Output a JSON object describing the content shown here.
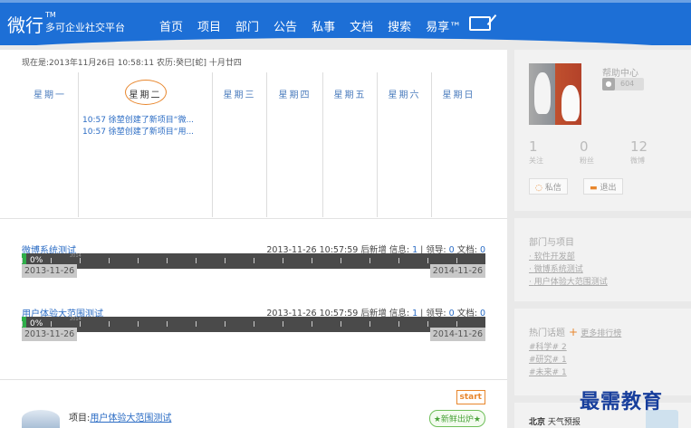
{
  "header": {
    "logo": "微行",
    "logo_tm": "TM",
    "logo_sub": "多可企业社交平台",
    "nav": [
      "首页",
      "项目",
      "部门",
      "公告",
      "私事",
      "文档",
      "搜索",
      "易享™"
    ]
  },
  "calendar": {
    "current_datetime": "现在是:2013年11月26日  10:58:11 农历:癸巳[蛇]  十月廿四",
    "days": [
      "星期一",
      "星期二",
      "星期三",
      "星期四",
      "星期五",
      "星期六",
      "星期日"
    ],
    "today_index": 1,
    "events": [
      "10:57 徐堃创建了新项目“微...",
      "10:57 徐堃创建了新项目“用..."
    ]
  },
  "projects": [
    {
      "title": "微博系统测试",
      "time": "2013-11-26 10:57:59",
      "new_label": "后新增",
      "info_label": "信息:",
      "info": "1",
      "lead_label": "领导:",
      "lead": "0",
      "doc_label": "文档:",
      "doc": "0",
      "progress_label": "0%",
      "progress": 0.01,
      "year": "2014",
      "start": "2013-11-26",
      "end": "2014-11-26"
    },
    {
      "title": "用户体验大范围测试",
      "time": "2013-11-26 10:57:59",
      "new_label": "后新增",
      "info_label": "信息:",
      "info": "1",
      "lead_label": "领导:",
      "lead": "0",
      "doc_label": "文档:",
      "doc": "0",
      "progress_label": "0%",
      "progress": 0.01,
      "year": "2014",
      "start": "2013-11-26",
      "end": "2014-11-26"
    }
  ],
  "feed": {
    "start_label": "start",
    "item_prefix": "项目:",
    "item_link": "用户体验大范围测试",
    "badge": "★新鲜出炉★"
  },
  "profile": {
    "help": "帮助中心",
    "help_count": "604",
    "stats": [
      {
        "value": "1",
        "label": "关注"
      },
      {
        "value": "0",
        "label": "粉丝"
      },
      {
        "value": "12",
        "label": "微博"
      }
    ],
    "btn_message": "私信",
    "btn_logout": "退出"
  },
  "departments": {
    "title": "部门与项目",
    "items": [
      "软件开发部",
      "微博系统测试",
      "用户体验大范围测试"
    ]
  },
  "topics": {
    "title": "热门话题",
    "more": "更多排行榜",
    "items": [
      "#科学# 2",
      "#研究# 1",
      "#未来# 1"
    ]
  },
  "weather": {
    "city": "北京",
    "label": "天气预报"
  },
  "watermark": "最需教育",
  "colors": {
    "header_blue": "#1d6fd6",
    "link_blue": "#2b6cc4",
    "accent_orange": "#e8862c",
    "progress_green": "#2fae4a"
  }
}
